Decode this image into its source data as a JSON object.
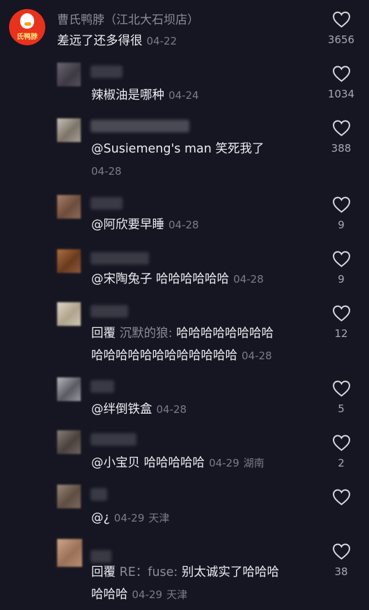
{
  "top_comment": {
    "author": "曹氏鸭脖（江北大石坝店）",
    "avatar_text": "氏鸭脖",
    "text": "差远了还多得很",
    "date": "04-22",
    "likes": "3656"
  },
  "replies": [
    {
      "text": "辣椒油是哪种",
      "date": "04-24",
      "likes": "1034"
    },
    {
      "text": "@Susiemeng's man 笑死我了",
      "date": "04-28",
      "likes": "388"
    },
    {
      "text": "@阿欣要早睡",
      "date": "04-28",
      "likes": "9"
    },
    {
      "text": "@宋陶兔子 哈哈哈哈哈哈",
      "date": "04-28",
      "likes": "9"
    },
    {
      "reply_prefix": "回覆",
      "reply_to": "沉默的狼:",
      "text": "哈哈哈哈哈哈哈哈",
      "text2": "哈哈哈哈哈哈哈哈哈哈哈哈",
      "date": "04-28",
      "likes": "12"
    },
    {
      "text": "@绊倒铁盒",
      "date": "04-28",
      "likes": "5"
    },
    {
      "text": "@小宝贝 哈哈哈哈哈",
      "date": "04-29",
      "location": "湖南",
      "likes": "2"
    },
    {
      "text": "@¿",
      "date": "04-29",
      "location": "天津",
      "likes": ""
    },
    {
      "reply_prefix": "回覆",
      "reply_to": "RE：fuse:",
      "text": "别太诚实了哈哈哈",
      "text2": "哈哈哈",
      "date": "04-29",
      "location": "天津",
      "likes": "38"
    }
  ]
}
